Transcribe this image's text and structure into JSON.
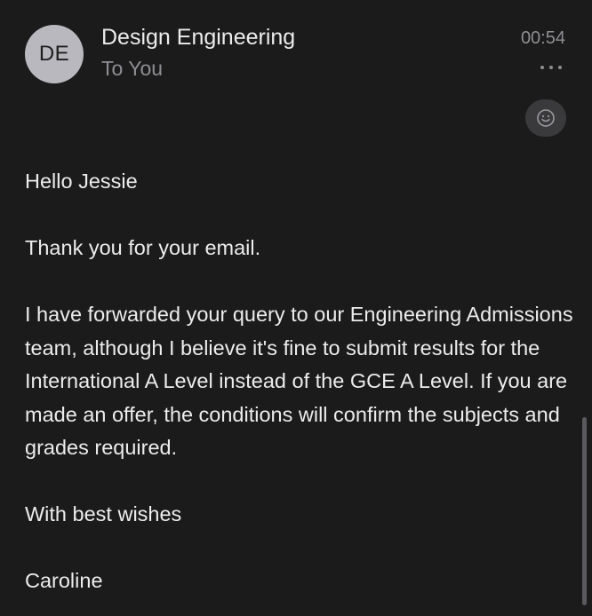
{
  "header": {
    "avatar_initials": "DE",
    "sender": "Design Engineering",
    "recipient": "To You",
    "time": "00:54",
    "more_icon": "ellipsis-icon",
    "reaction_icon": "smiley-icon"
  },
  "message": {
    "greeting": "Hello Jessie",
    "paragraph_1": "Thank you for your email.",
    "paragraph_2": "I have forwarded your query to our Engineering Admissions team, although I believe it's fine to submit results for the International A Level instead of the GCE A Level. If you are made an offer, the conditions will confirm the subjects and grades required.",
    "sign_off": "With best wishes",
    "signature": "Caroline"
  },
  "colors": {
    "background": "#1b1b1b",
    "primary_text": "#ececec",
    "secondary_text": "#8e8e93",
    "avatar": "#b8b8be",
    "reaction_button": "#3a3a3c"
  }
}
